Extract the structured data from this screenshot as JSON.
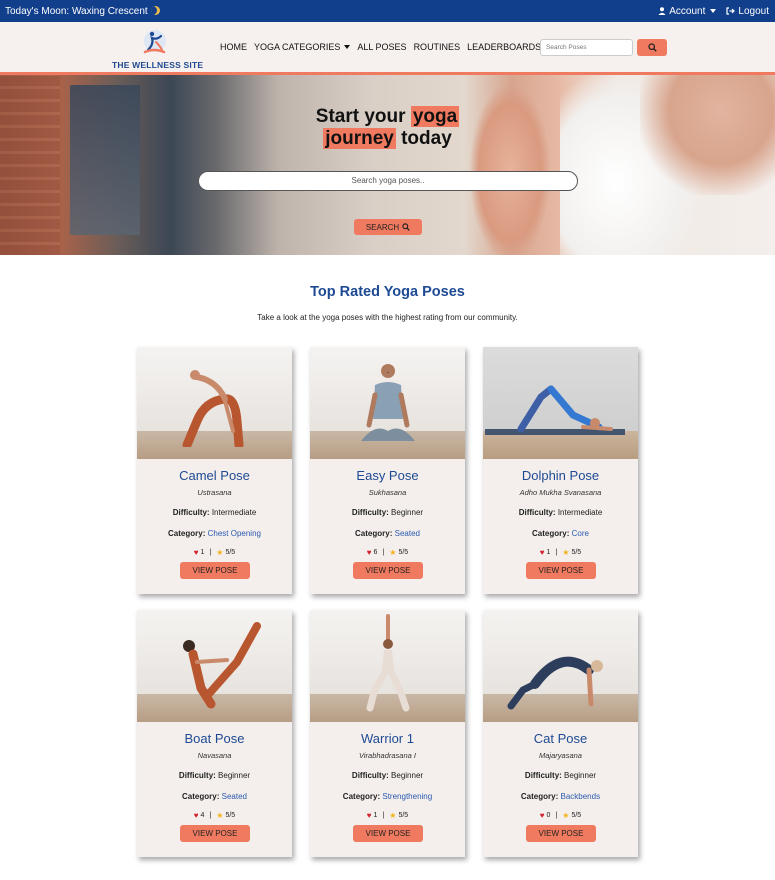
{
  "topbar": {
    "moon_text": "Today's Moon: Waxing Crescent",
    "account_label": "Account",
    "logout_label": "Logout"
  },
  "navbar": {
    "logo_text": "THE WELLNESS SITE",
    "links": [
      "HOME",
      "YOGA CATEGORIES",
      "ALL POSES",
      "ROUTINES",
      "LEADERBOARDS"
    ],
    "search_placeholder": "Search Poses"
  },
  "hero": {
    "title_pre": "Start your ",
    "title_highlight_1": "yoga",
    "title_highlight_2": "journey",
    "title_post": " today",
    "search_placeholder": "Search yoga poses..",
    "search_button": "SEARCH"
  },
  "section": {
    "title": "Top Rated Yoga Poses",
    "subtitle": "Take a look at the yoga poses with the highest rating from our community."
  },
  "labels": {
    "difficulty": "Difficulty:",
    "category": "Category:",
    "view_button": "VIEW POSE",
    "separator": "|"
  },
  "cards": [
    {
      "name": "Camel Pose",
      "sanskrit": "Ustrasana",
      "difficulty": "Intermediate",
      "category": "Chest Opening",
      "likes": "1",
      "rating": "5/5"
    },
    {
      "name": "Easy Pose",
      "sanskrit": "Sukhasana",
      "difficulty": "Beginner",
      "category": "Seated",
      "likes": "6",
      "rating": "5/5"
    },
    {
      "name": "Dolphin Pose",
      "sanskrit": "Adho Mukha Svanasana",
      "difficulty": "Intermediate",
      "category": "Core",
      "likes": "1",
      "rating": "5/5"
    },
    {
      "name": "Boat Pose",
      "sanskrit": "Navasana",
      "difficulty": "Beginner",
      "category": "Seated",
      "likes": "4",
      "rating": "5/5"
    },
    {
      "name": "Warrior 1",
      "sanskrit": "Virabhadrasana I",
      "difficulty": "Beginner",
      "category": "Strengthening",
      "likes": "1",
      "rating": "5/5"
    },
    {
      "name": "Cat Pose",
      "sanskrit": "Majaryasana",
      "difficulty": "Beginner",
      "category": "Backbends",
      "likes": "0",
      "rating": "5/5"
    }
  ],
  "colors": {
    "topbar": "#123f8c",
    "accent": "#f07a5f",
    "brand_blue": "#1e4a94",
    "link_blue": "#2a5bb0",
    "card_bg": "#f4efec",
    "heart": "#d0202a",
    "star": "#f2b21b"
  }
}
